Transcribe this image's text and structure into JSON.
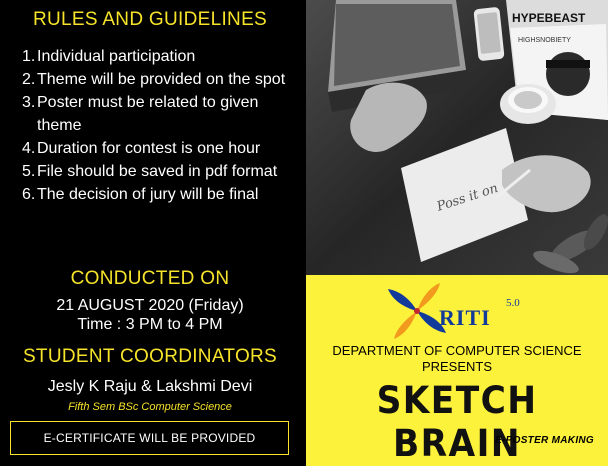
{
  "rules": {
    "heading": "RULES AND GUIDELINES",
    "items": [
      {
        "num": "1.",
        "text": "Individual participation"
      },
      {
        "num": "2.",
        "text": "Theme will be provided on the spot"
      },
      {
        "num": "3.",
        "text": "Poster must be related to given theme"
      },
      {
        "num": "4.",
        "text": "Duration for contest is one hour"
      },
      {
        "num": "5.",
        "text": "File should be saved in pdf format"
      },
      {
        "num": "6.",
        "text": "The decision of jury will be final"
      }
    ]
  },
  "conducted": {
    "heading": "CONDUCTED ON",
    "date": "21 AUGUST 2020 (Friday)",
    "time": "Time : 3 PM to 4 PM"
  },
  "coordinators": {
    "heading": "STUDENT COORDINATORS",
    "names": "Jesly K Raju & Lakshmi Devi",
    "subtitle": "Fifth Sem BSc Computer Science"
  },
  "certificate": {
    "text": "E-CERTIFICATE WILL BE PROVIDED"
  },
  "photo_texts": {
    "magazine_title": "HYPEBEAST",
    "magazine_sub": "HIGHSNOBIETY",
    "sketch_text": "Poss it on"
  },
  "brand": {
    "logo_text": "RITI",
    "logo_version": "5.0",
    "department": "DEPARTMENT OF COMPUTER SCIENCE",
    "presents": "PRESENTS",
    "title": "SKETCH BRAIN",
    "subtitle": "E-POSTER MAKING"
  },
  "colors": {
    "accent_yellow": "#f6e32a",
    "panel_yellow": "#fdf23b",
    "logo_blue": "#123a9a",
    "logo_orange": "#f29a1e",
    "background": "#000000"
  }
}
